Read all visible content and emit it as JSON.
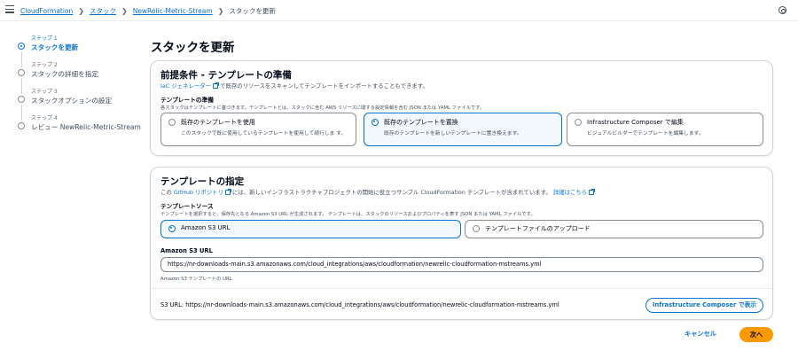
{
  "breadcrumbs": {
    "items": [
      "CloudFormation",
      "スタック",
      "NewRelic-Metric-Stream"
    ],
    "current": "スタックを更新"
  },
  "steps": [
    {
      "num": "ステップ 1",
      "label": "スタックを更新",
      "active": true
    },
    {
      "num": "ステップ 2",
      "label": "スタックの詳細を指定",
      "active": false
    },
    {
      "num": "ステップ 3",
      "label": "スタックオプションの設定",
      "active": false
    },
    {
      "num": "ステップ 4",
      "label": "レビュー NewRelic-Metric-Stream",
      "active": false
    }
  ],
  "page_title": "スタックを更新",
  "prereq": {
    "title": "前提条件 - テンプレートの準備",
    "desc_link": "IaC ジェネレーター",
    "desc_rest": "で既存のリソースをスキャンしてテンプレートをインポートすることもできます。",
    "field_label": "テンプレートの準備",
    "field_desc": "各スタックはテンプレートに基づきます。テンプレートとは、スタックに含む AWS リソースに関する設定情報を含む JSON または YAML ファイルです。",
    "options": [
      {
        "title": "既存のテンプレートを使用",
        "desc": "このスタックで既に使用しているテンプレートを使用して続行しま す。",
        "selected": false
      },
      {
        "title": "既存のテンプレートを置換",
        "desc": "既存のテンプレートを新しいテンプレートに置き換えます。",
        "selected": true
      },
      {
        "title": "Infrastructure Composer で編集",
        "desc": "ビジュアルビルダーでテンプレートを編集します。",
        "selected": false
      }
    ]
  },
  "spec": {
    "title": "テンプレートの指定",
    "desc_prefix": "この",
    "desc_link": "GitHub リポジトリ",
    "desc_rest": "には、新しいインフラストラクチャプロジェクトの開始に役立つサンプル CloudFormation テンプレートが含まれています。",
    "more_link": "詳細はこちら",
    "source_label": "テンプレートソース",
    "source_desc": "テンプレートを選択すると、保存先となる Amazon S3 URL が生成されます。 テンプレートは、スタックのリソースおよびプロパティを表す JSON または YAML ファイルです。",
    "sources": [
      {
        "label": "Amazon S3 URL",
        "selected": true
      },
      {
        "label": "テンプレートファイルのアップロード",
        "selected": false
      }
    ],
    "s3_label": "Amazon S3 URL",
    "s3_value": "https://nr-downloads-main.s3.amazonaws.com/cloud_integrations/aws/cloudformation/newrelic-cloudformation-mstreams.yml",
    "s3_hint": "Amazon S3 テンプレートの URL",
    "s3_url_line": "S3 URL:  https://nr-downloads-main.s3.amazonaws.com/cloud_integrations/aws/cloudformation/newrelic-cloudformation-mstreams.yml",
    "composer_button": "Infrastructure Composer で表示"
  },
  "footer": {
    "cancel": "キャンセル",
    "next": "次へ"
  },
  "colors": {
    "accent": "#0972d3",
    "primary_button": "#ff9900"
  }
}
